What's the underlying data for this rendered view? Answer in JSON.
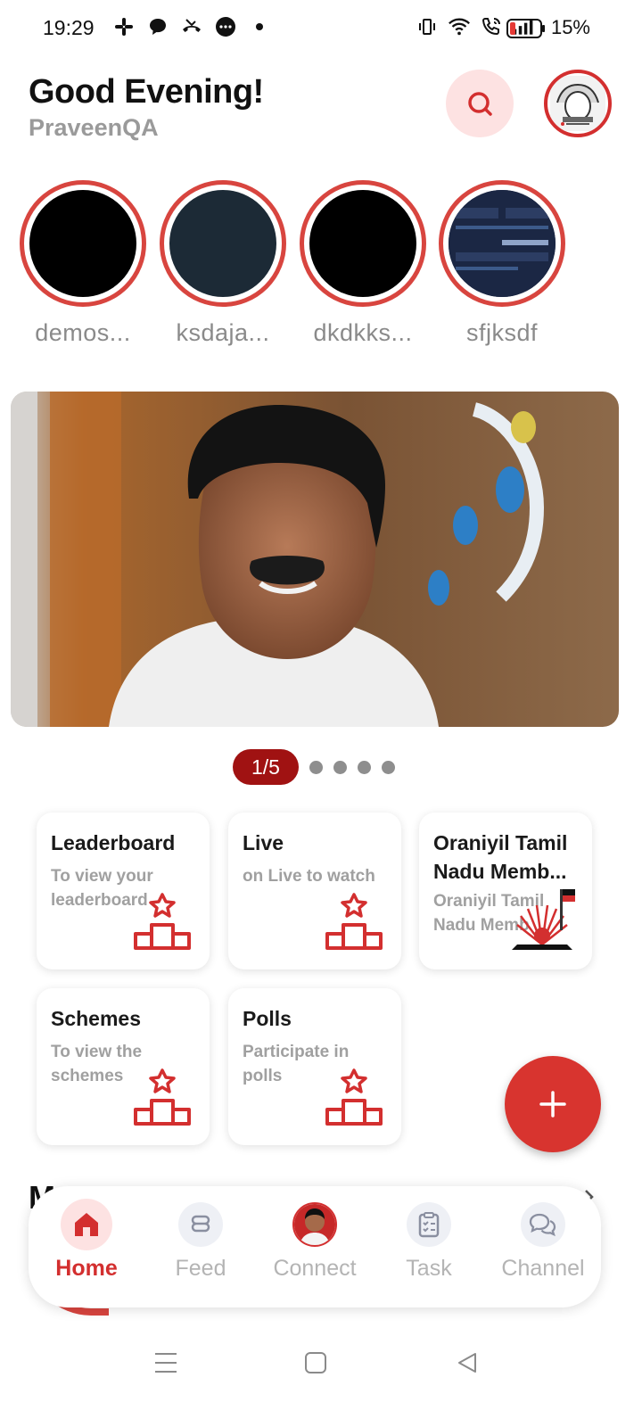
{
  "status_bar": {
    "time": "19:29",
    "battery_percent": "15%",
    "left_icons": [
      "slack-icon",
      "chat-bubble-icon",
      "missed-call-icon",
      "messenger-icon",
      "dot-icon"
    ],
    "right_icons": [
      "vibrate-icon",
      "wifi-icon",
      "wifi-calling-icon",
      "signal-icon",
      "battery-icon"
    ]
  },
  "header": {
    "greeting": "Good Evening!",
    "username": "PraveenQA"
  },
  "stories": [
    {
      "label": "demos...",
      "color": "#000000"
    },
    {
      "label": "ksdaja...",
      "color": "#1c2a36"
    },
    {
      "label": "dkdkks...",
      "color": "#000000"
    },
    {
      "label": "sfjksdf",
      "color": "#1a2b45"
    }
  ],
  "pager": {
    "current": "1/5",
    "total_dots": 4
  },
  "cards": [
    {
      "title": "Leaderboard",
      "subtitle": "To view your leaderboard",
      "icon": "podium-star-icon"
    },
    {
      "title": "Live",
      "subtitle": "on Live to watch",
      "icon": "podium-star-icon"
    },
    {
      "title": "Oraniyil Tamil Nadu Memb...",
      "subtitle": "Oraniyil Tamil Nadu Memb",
      "icon": "party-flag-logo-icon"
    },
    {
      "title": "Schemes",
      "subtitle": "To view the schemes",
      "icon": "podium-star-icon"
    },
    {
      "title": "Polls",
      "subtitle": "Participate in polls",
      "icon": "podium-star-icon"
    }
  ],
  "section_peek": "M",
  "bottom_nav": [
    {
      "label": "Home",
      "icon": "home-icon",
      "active": true
    },
    {
      "label": "Feed",
      "icon": "feed-icon",
      "active": false
    },
    {
      "label": "Connect",
      "icon": "connect-avatar-icon",
      "active": false
    },
    {
      "label": "Task",
      "icon": "clipboard-icon",
      "active": false
    },
    {
      "label": "Channel",
      "icon": "chat-icon",
      "active": false
    }
  ],
  "colors": {
    "accent": "#d32f2f",
    "pager_active": "#a01212",
    "muted_text": "#9a9a9a"
  }
}
